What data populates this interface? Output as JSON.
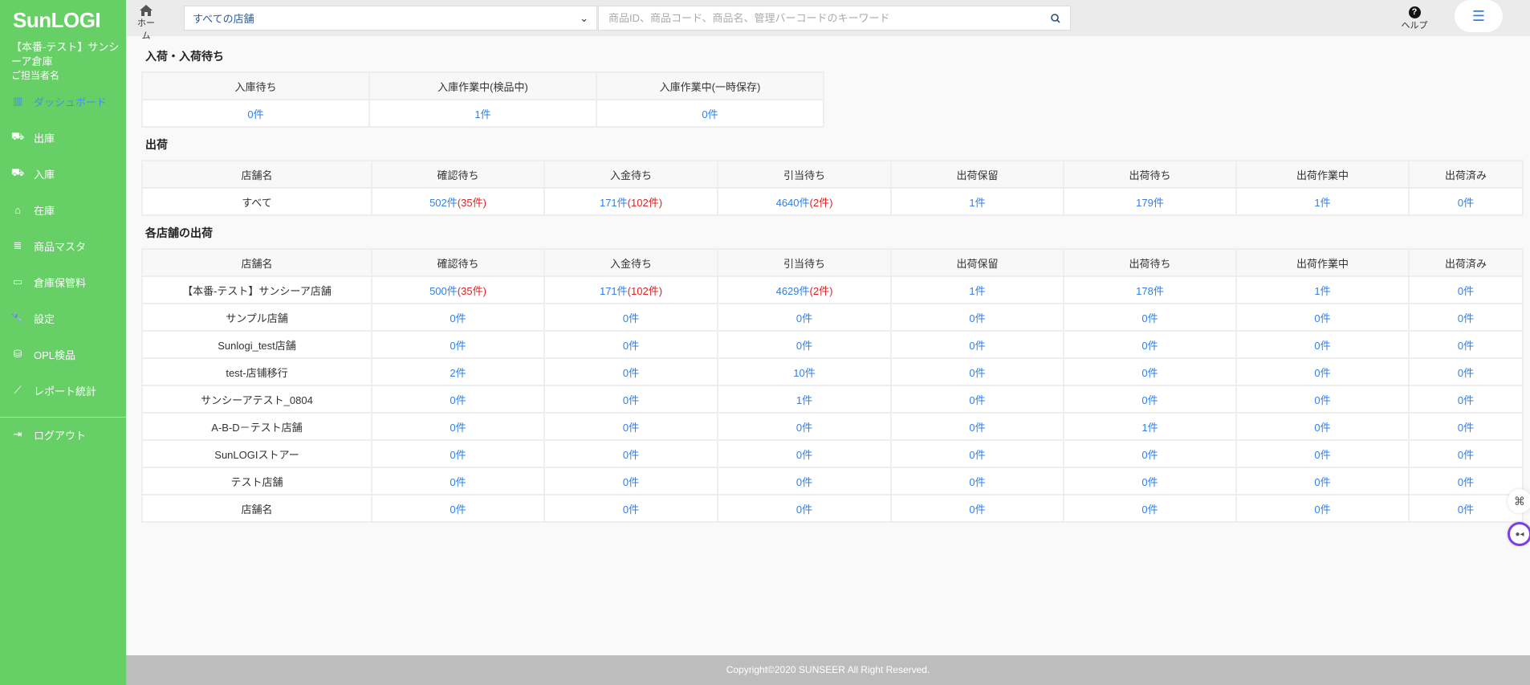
{
  "sidebar": {
    "logo": "SunLOGI",
    "warehouse": "【本番-テスト】サンシーア倉庫",
    "person": "ご担当者名",
    "items": [
      {
        "label": "ダッシュボード",
        "icon": "bar-chart-icon"
      },
      {
        "label": "出庫",
        "icon": "truck-out-icon"
      },
      {
        "label": "入庫",
        "icon": "truck-in-icon"
      },
      {
        "label": "在庫",
        "icon": "warehouse-icon"
      },
      {
        "label": "商品マスタ",
        "icon": "database-icon"
      },
      {
        "label": "倉庫保管料",
        "icon": "fee-icon"
      },
      {
        "label": "設定",
        "icon": "wrench-icon"
      },
      {
        "label": "OPL検品",
        "icon": "inspect-icon"
      },
      {
        "label": "レポート統計",
        "icon": "line-chart-icon"
      }
    ],
    "logout": "ログアウト"
  },
  "header": {
    "home": "ホーム",
    "store_select": "すべての店舗",
    "search_placeholder": "商品ID、商品コード、商品名、管理バーコードのキーワード",
    "help": "ヘルプ"
  },
  "inbound": {
    "title": "入荷・入荷待ち",
    "headers": [
      "入庫待ち",
      "入庫作業中(検品中)",
      "入庫作業中(一時保存)"
    ],
    "values": [
      "0件",
      "1件",
      "0件"
    ]
  },
  "shipping": {
    "title": "出荷",
    "headers": [
      "店舗名",
      "確認待ち",
      "入金待ち",
      "引当待ち",
      "出荷保留",
      "出荷待ち",
      "出荷作業中",
      "出荷済み"
    ],
    "rows": [
      [
        "すべて",
        {
          "v": "502件",
          "r": "(35件)"
        },
        {
          "v": "171件",
          "r": "(102件)"
        },
        {
          "v": "4640件",
          "r": "(2件)"
        },
        {
          "v": "1件"
        },
        {
          "v": "179件"
        },
        {
          "v": "1件"
        },
        {
          "v": "0件"
        }
      ]
    ]
  },
  "stores": {
    "title": "各店舗の出荷",
    "headers": [
      "店舗名",
      "確認待ち",
      "入金待ち",
      "引当待ち",
      "出荷保留",
      "出荷待ち",
      "出荷作業中",
      "出荷済み"
    ],
    "rows": [
      [
        "【本番-テスト】サンシーア店舗",
        {
          "v": "500件",
          "r": "(35件)"
        },
        {
          "v": "171件",
          "r": "(102件)"
        },
        {
          "v": "4629件",
          "r": "(2件)"
        },
        {
          "v": "1件"
        },
        {
          "v": "178件"
        },
        {
          "v": "1件"
        },
        {
          "v": "0件"
        }
      ],
      [
        "サンプル店舗",
        {
          "v": "0件"
        },
        {
          "v": "0件"
        },
        {
          "v": "0件"
        },
        {
          "v": "0件"
        },
        {
          "v": "0件"
        },
        {
          "v": "0件"
        },
        {
          "v": "0件"
        }
      ],
      [
        "Sunlogi_test店舗",
        {
          "v": "0件"
        },
        {
          "v": "0件"
        },
        {
          "v": "0件"
        },
        {
          "v": "0件"
        },
        {
          "v": "0件"
        },
        {
          "v": "0件"
        },
        {
          "v": "0件"
        }
      ],
      [
        "test-店铺移行",
        {
          "v": "2件"
        },
        {
          "v": "0件"
        },
        {
          "v": "10件"
        },
        {
          "v": "0件"
        },
        {
          "v": "0件"
        },
        {
          "v": "0件"
        },
        {
          "v": "0件"
        }
      ],
      [
        "サンシーアテスト_0804",
        {
          "v": "0件"
        },
        {
          "v": "0件"
        },
        {
          "v": "1件"
        },
        {
          "v": "0件"
        },
        {
          "v": "0件"
        },
        {
          "v": "0件"
        },
        {
          "v": "0件"
        }
      ],
      [
        "A-B-D－テスト店舗",
        {
          "v": "0件"
        },
        {
          "v": "0件"
        },
        {
          "v": "0件"
        },
        {
          "v": "0件"
        },
        {
          "v": "1件"
        },
        {
          "v": "0件"
        },
        {
          "v": "0件"
        }
      ],
      [
        "SunLOGIストアー",
        {
          "v": "0件"
        },
        {
          "v": "0件"
        },
        {
          "v": "0件"
        },
        {
          "v": "0件"
        },
        {
          "v": "0件"
        },
        {
          "v": "0件"
        },
        {
          "v": "0件"
        }
      ],
      [
        "テスト店舗",
        {
          "v": "0件"
        },
        {
          "v": "0件"
        },
        {
          "v": "0件"
        },
        {
          "v": "0件"
        },
        {
          "v": "0件"
        },
        {
          "v": "0件"
        },
        {
          "v": "0件"
        }
      ],
      [
        "店舗名",
        {
          "v": "0件"
        },
        {
          "v": "0件"
        },
        {
          "v": "0件"
        },
        {
          "v": "0件"
        },
        {
          "v": "0件"
        },
        {
          "v": "0件"
        },
        {
          "v": "0件"
        }
      ]
    ]
  },
  "footer": "Copyright©2020 SUNSEER All Right Reserved.",
  "colors": {
    "sidebar": "#66cf66",
    "link": "#2f80ed",
    "alert": "#e02020"
  }
}
